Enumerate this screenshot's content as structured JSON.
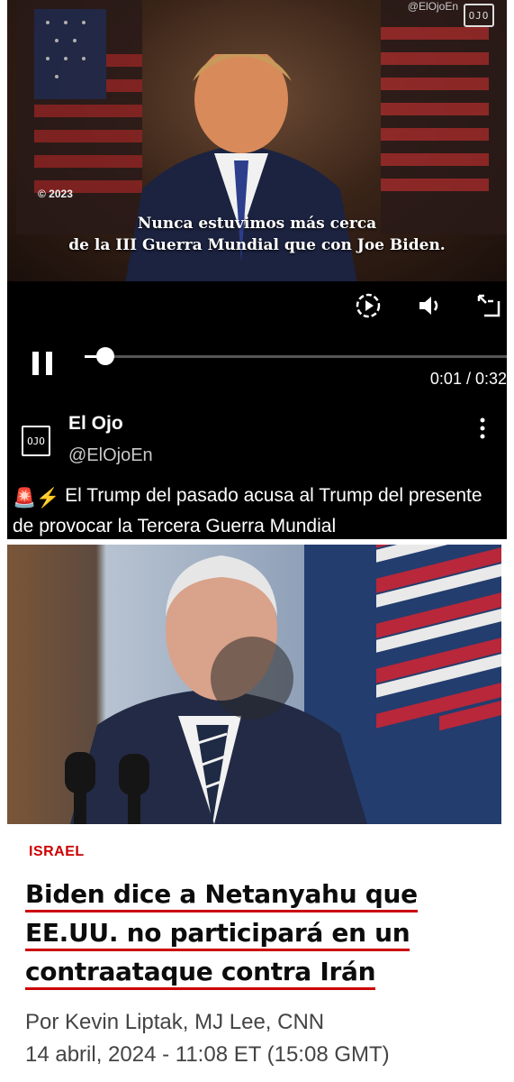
{
  "video": {
    "watermark_handle": "@ElOjoEn",
    "watermark_logo": "OJO",
    "copyright": "© 2023",
    "subtitle_line1": "Nunca estuvimos más cerca",
    "subtitle_line2": "de la III Guerra Mundial que con Joe Biden.",
    "progress_fraction": 0.05,
    "time": "0:01 / 0:32",
    "icons": [
      "quality-icon",
      "volume-icon",
      "fullscreen-icon",
      "pause-icon"
    ]
  },
  "account": {
    "avatar_text": "OJO",
    "name": "El Ojo",
    "handle": "@ElOjoEn"
  },
  "post": {
    "emoji": "🚨⚡",
    "text": "El Trump del pasado acusa al Trump del presente de provocar la Tercera Guerra Mundial"
  },
  "article": {
    "category": "ISRAEL",
    "headline_lines": [
      "Biden dice a Netanyahu que",
      "EE.UU. no participará en un",
      "contraataque contra Irán"
    ],
    "byline": "Por Kevin Liptak, MJ Lee, CNN",
    "date": "14 abril, 2024 - 11:08 ET (15:08 GMT)"
  },
  "colors": {
    "accent_red": "#cc0000",
    "video_bg": "#000000"
  }
}
